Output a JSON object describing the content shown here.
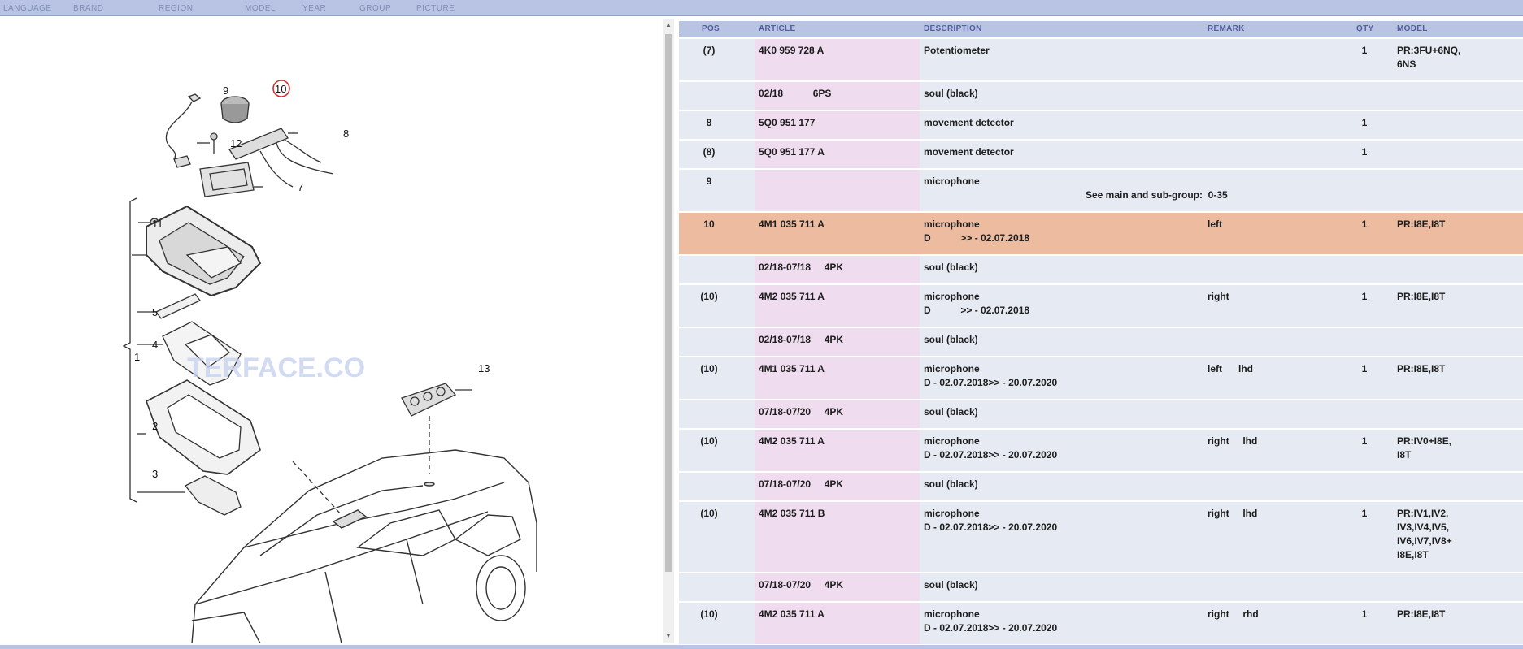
{
  "nav": [
    "LANGUAGE",
    "BRAND",
    "REGION",
    "MODEL",
    "YEAR",
    "GROUP",
    "PICTURE"
  ],
  "illustration": {
    "watermark": "TERFACE.CO",
    "callouts": [
      "9",
      "10",
      "12",
      "8",
      "7",
      "11",
      "5",
      "4",
      "1",
      "2",
      "3",
      "13"
    ],
    "highlighted_callout": "10"
  },
  "table": {
    "headers": {
      "pos": "POS",
      "article": "ARTICLE",
      "description": "DESCRIPTION",
      "remark": "REMARK",
      "qty": "QTY",
      "model": "MODEL"
    },
    "rows": [
      {
        "pos": "(7)",
        "article": "4K0 959 728 A",
        "description": "Potentiometer",
        "remark": "",
        "qty": "1",
        "model": "PR:3FU+6NQ,\n6NS"
      },
      {
        "pos": "",
        "article": "02/18           6PS",
        "description": "soul (black)",
        "remark": "",
        "qty": "",
        "model": ""
      },
      {
        "pos": "8",
        "article": "5Q0 951 177",
        "description": "movement detector",
        "remark": "",
        "qty": "1",
        "model": ""
      },
      {
        "pos": "(8)",
        "article": "5Q0 951 177 A",
        "description": "movement detector",
        "remark": "",
        "qty": "1",
        "model": ""
      },
      {
        "pos": "9",
        "article": "",
        "description": "microphone",
        "remark": "",
        "qty": "",
        "model": "",
        "note": "See main and sub-group:  0-35"
      },
      {
        "pos": "10",
        "article": "4M1 035 711 A",
        "description": "microphone\nD           >> - 02.07.2018",
        "remark": "left",
        "qty": "1",
        "model": "PR:I8E,I8T",
        "highlight": true
      },
      {
        "pos": "",
        "article": "02/18-07/18     4PK",
        "description": "soul (black)",
        "remark": "",
        "qty": "",
        "model": ""
      },
      {
        "pos": "(10)",
        "article": "4M2 035 711 A",
        "description": "microphone\nD           >> - 02.07.2018",
        "remark": "right",
        "qty": "1",
        "model": "PR:I8E,I8T"
      },
      {
        "pos": "",
        "article": "02/18-07/18     4PK",
        "description": "soul (black)",
        "remark": "",
        "qty": "",
        "model": ""
      },
      {
        "pos": "(10)",
        "article": "4M1 035 711 A",
        "description": "microphone\nD - 02.07.2018>> - 20.07.2020",
        "remark": "left      lhd",
        "qty": "1",
        "model": "PR:I8E,I8T"
      },
      {
        "pos": "",
        "article": "07/18-07/20     4PK",
        "description": "soul (black)",
        "remark": "",
        "qty": "",
        "model": ""
      },
      {
        "pos": "(10)",
        "article": "4M2 035 711 A",
        "description": "microphone\nD - 02.07.2018>> - 20.07.2020",
        "remark": "right     lhd",
        "qty": "1",
        "model": "PR:IV0+I8E,\nI8T"
      },
      {
        "pos": "",
        "article": "07/18-07/20     4PK",
        "description": "soul (black)",
        "remark": "",
        "qty": "",
        "model": ""
      },
      {
        "pos": "(10)",
        "article": "4M2 035 711 B",
        "description": "microphone\nD - 02.07.2018>> - 20.07.2020",
        "remark": "right     lhd",
        "qty": "1",
        "model": "PR:IV1,IV2,\nIV3,IV4,IV5,\nIV6,IV7,IV8+\nI8E,I8T"
      },
      {
        "pos": "",
        "article": "07/18-07/20     4PK",
        "description": "soul (black)",
        "remark": "",
        "qty": "",
        "model": ""
      },
      {
        "pos": "(10)",
        "article": "4M2 035 711 A",
        "description": "microphone\nD - 02.07.2018>> - 20.07.2020",
        "remark": "right     rhd",
        "qty": "1",
        "model": "PR:I8E,I8T"
      }
    ]
  },
  "colors": {
    "header": "#b9c4e4",
    "row": "#e6eaf3",
    "article": "#efdcef",
    "highlight": "#edbb9f",
    "callout_ring": "#d43030"
  }
}
